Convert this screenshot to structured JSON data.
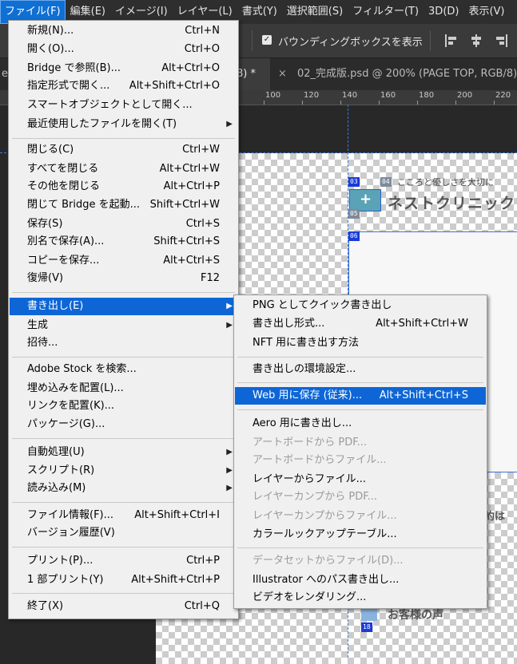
{
  "menubar": {
    "items": [
      "ファイル(F)",
      "編集(E)",
      "イメージ(I)",
      "レイヤー(L)",
      "書式(Y)",
      "選択範囲(S)",
      "フィルター(T)",
      "3D(D)",
      "表示(V)"
    ],
    "active_index": 0
  },
  "options_bar": {
    "bounding_box_checked": true,
    "bounding_box_label": "バウンディングボックスを表示"
  },
  "tabs": {
    "left_fragment": "eb",
    "active_fragment": "8) *",
    "active_close": "×",
    "second": "02_完成版.psd @ 200% (PAGE TOP, RGB/8)"
  },
  "ruler": {
    "labels": [
      "100",
      "120",
      "140",
      "160",
      "180",
      "200",
      "220"
    ]
  },
  "file_menu": {
    "items": [
      {
        "label": "新規(N)...",
        "shortcut": "Ctrl+N"
      },
      {
        "label": "開く(O)...",
        "shortcut": "Ctrl+O"
      },
      {
        "label": "Bridge で参照(B)...",
        "shortcut": "Alt+Ctrl+O"
      },
      {
        "label": "指定形式で開く...",
        "shortcut": "Alt+Shift+Ctrl+O"
      },
      {
        "label": "スマートオブジェクトとして開く...",
        "shortcut": ""
      },
      {
        "label": "最近使用したファイルを開く(T)",
        "shortcut": "",
        "submenu": true
      },
      {
        "label": "閉じる(C)",
        "shortcut": "Ctrl+W"
      },
      {
        "label": "すべてを閉じる",
        "shortcut": "Alt+Ctrl+W"
      },
      {
        "label": "その他を閉じる",
        "shortcut": "Alt+Ctrl+P"
      },
      {
        "label": "閉じて Bridge を起動...",
        "shortcut": "Shift+Ctrl+W"
      },
      {
        "label": "保存(S)",
        "shortcut": "Ctrl+S"
      },
      {
        "label": "別名で保存(A)...",
        "shortcut": "Shift+Ctrl+S"
      },
      {
        "label": "コピーを保存...",
        "shortcut": "Alt+Ctrl+S"
      },
      {
        "label": "復帰(V)",
        "shortcut": "F12"
      },
      {
        "label": "書き出し(E)",
        "shortcut": "",
        "submenu": true,
        "highlighted": true
      },
      {
        "label": "生成",
        "shortcut": "",
        "submenu": true
      },
      {
        "label": "招待...",
        "shortcut": ""
      },
      {
        "label": "Adobe Stock を検索...",
        "shortcut": ""
      },
      {
        "label": "埋め込みを配置(L)...",
        "shortcut": ""
      },
      {
        "label": "リンクを配置(K)...",
        "shortcut": ""
      },
      {
        "label": "パッケージ(G)...",
        "shortcut": ""
      },
      {
        "label": "自動処理(U)",
        "shortcut": "",
        "submenu": true
      },
      {
        "label": "スクリプト(R)",
        "shortcut": "",
        "submenu": true
      },
      {
        "label": "読み込み(M)",
        "shortcut": "",
        "submenu": true
      },
      {
        "label": "ファイル情報(F)...",
        "shortcut": "Alt+Shift+Ctrl+I"
      },
      {
        "label": "バージョン履歴(V)",
        "shortcut": ""
      },
      {
        "label": "プリント(P)...",
        "shortcut": "Ctrl+P"
      },
      {
        "label": "1 部プリント(Y)",
        "shortcut": "Alt+Shift+Ctrl+P"
      },
      {
        "label": "終了(X)",
        "shortcut": "Ctrl+Q"
      }
    ]
  },
  "export_menu": {
    "items": [
      {
        "label": "PNG としてクイック書き出し",
        "shortcut": ""
      },
      {
        "label": "書き出し形式...",
        "shortcut": "Alt+Shift+Ctrl+W"
      },
      {
        "label": "NFT 用に書き出す方法",
        "shortcut": ""
      },
      {
        "label": "書き出しの環境設定...",
        "shortcut": ""
      },
      {
        "label": "Web 用に保存 (従来)...",
        "shortcut": "Alt+Shift+Ctrl+S",
        "highlighted": true
      },
      {
        "label": "Aero 用に書き出し...",
        "shortcut": ""
      },
      {
        "label": "アートボードから PDF...",
        "shortcut": "",
        "disabled": true
      },
      {
        "label": "アートボードからファイル...",
        "shortcut": "",
        "disabled": true
      },
      {
        "label": "レイヤーからファイル...",
        "shortcut": ""
      },
      {
        "label": "レイヤーカンプから PDF...",
        "shortcut": "",
        "disabled": true
      },
      {
        "label": "レイヤーカンプからファイル...",
        "shortcut": "",
        "disabled": true
      },
      {
        "label": "カラールックアップテーブル...",
        "shortcut": ""
      },
      {
        "label": "データセットからファイル(D)...",
        "shortcut": "",
        "disabled": true
      },
      {
        "label": "Illustrator へのパス書き出し...",
        "shortcut": ""
      },
      {
        "label": "ビデオをレンダリング...",
        "shortcut": ""
      }
    ]
  },
  "canvas": {
    "tagline": "こころと優しさを大切に",
    "clinic_name": "ネストクリニック",
    "fragment_text": "約は",
    "voice_title": "お客様の声",
    "slice_tags": [
      "04",
      "03",
      "05",
      "06",
      "18"
    ]
  }
}
